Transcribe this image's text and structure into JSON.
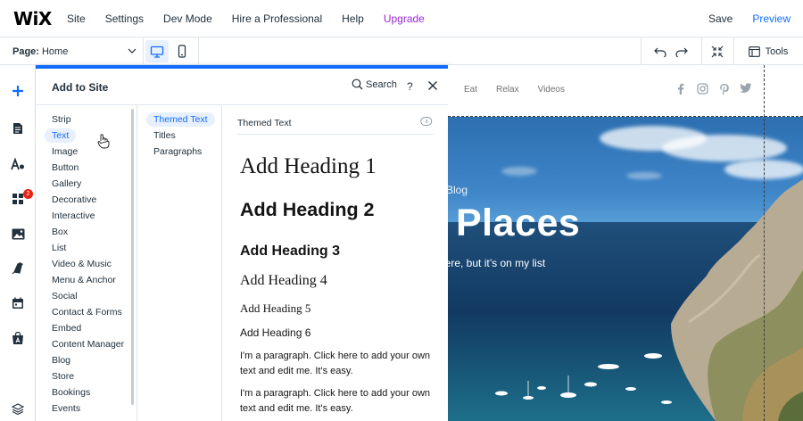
{
  "topbar": {
    "logo": "WiX",
    "menu": [
      "Site",
      "Settings",
      "Dev Mode",
      "Hire a Professional",
      "Help",
      "Upgrade"
    ],
    "save": "Save",
    "preview": "Preview"
  },
  "toolbar": {
    "page_label": "Page:",
    "page_value": "Home",
    "tools": "Tools"
  },
  "rail": {
    "badge_count": "2"
  },
  "panel": {
    "title": "Add to Site",
    "search": "Search",
    "help": "?",
    "categories": [
      "Strip",
      "Text",
      "Image",
      "Button",
      "Gallery",
      "Decorative",
      "Interactive",
      "Box",
      "List",
      "Video & Music",
      "Menu & Anchor",
      "Social",
      "Contact & Forms",
      "Embed",
      "Content Manager",
      "Blog",
      "Store",
      "Bookings",
      "Events"
    ],
    "active_category": "Text",
    "subcategories": [
      "Themed Text",
      "Titles",
      "Paragraphs"
    ],
    "active_subcategory": "Themed Text",
    "content_title": "Themed Text",
    "headings": [
      "Add Heading 1",
      "Add Heading 2",
      "Add Heading 3",
      "Add Heading 4",
      "Add Heading 5",
      "Add Heading 6"
    ],
    "paragraphs": [
      "I'm a paragraph. Click here to add your own text and edit me. It's easy.",
      "I'm a paragraph. Click here to add your own text and edit me. It's easy."
    ]
  },
  "site": {
    "nav": [
      "Eat",
      "Relax",
      "Videos"
    ],
    "blog_label": "l Blog",
    "hero_title": "Places",
    "hero_subtitle": "here, but it’s on my list"
  },
  "colors": {
    "accent": "#116dff",
    "upgrade": "#9a27d5",
    "badge": "#e62214"
  }
}
